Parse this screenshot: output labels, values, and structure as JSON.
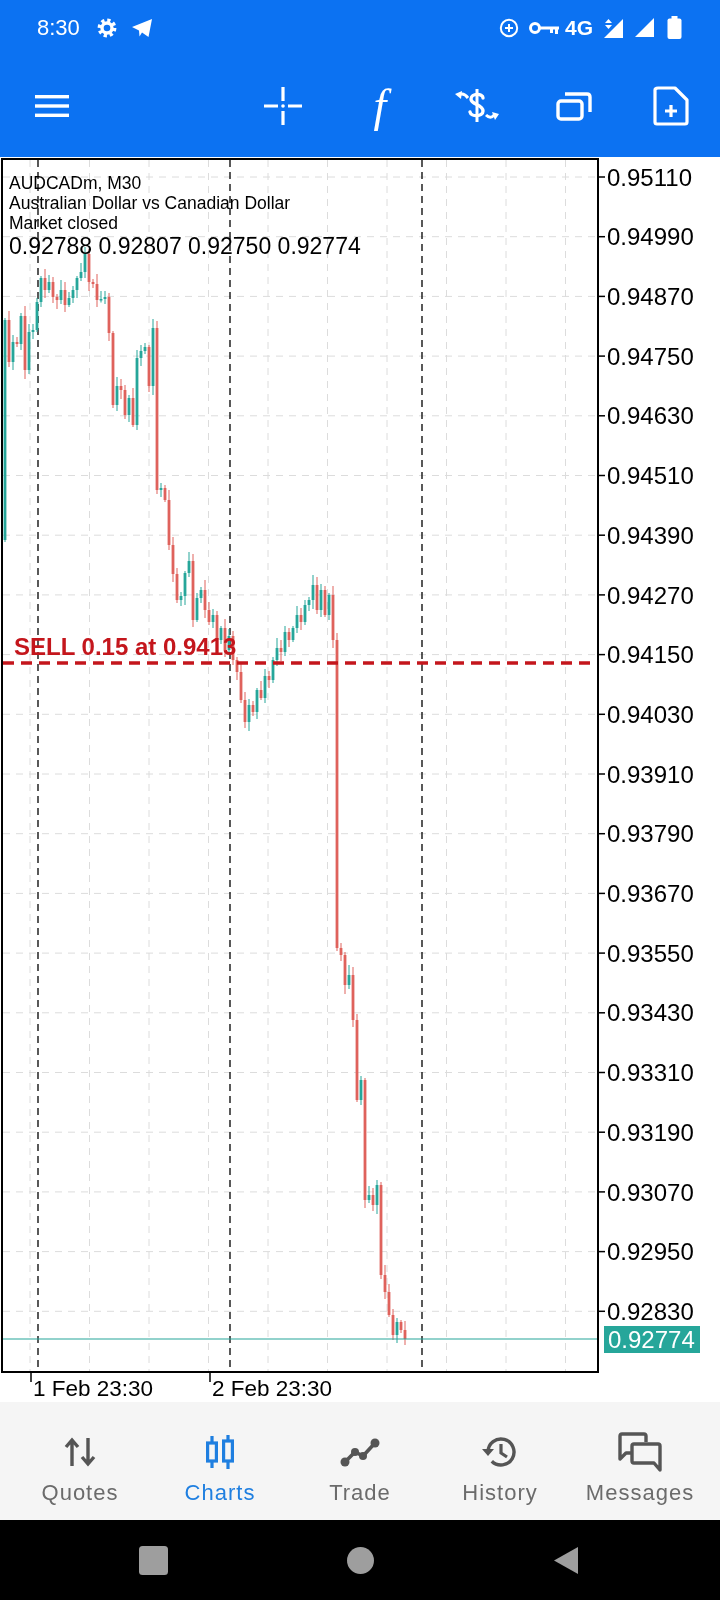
{
  "status_bar": {
    "time": "8:30",
    "network": "4G"
  },
  "toolbar": {
    "function_symbol": "f"
  },
  "chart": {
    "symbol": "AUDCADm, M30",
    "description": "Australian Dollar vs Canadian Dollar",
    "market_status": "Market closed",
    "ohlc": "0.92788 0.92807 0.92750 0.92774",
    "order_line": {
      "label": "SELL 0.15 at 0.9413"
    },
    "price_axis": [
      "0.95110",
      "0.94990",
      "0.94870",
      "0.94750",
      "0.94630",
      "0.94510",
      "0.94390",
      "0.94270",
      "0.94150",
      "0.94030",
      "0.93910",
      "0.93790",
      "0.93670",
      "0.93550",
      "0.93430",
      "0.93310",
      "0.93190",
      "0.93070",
      "0.92950",
      "0.92830"
    ],
    "current_price": "0.92774",
    "time_axis": [
      "1 Feb 23:30",
      "2 Feb 23:30"
    ]
  },
  "bottom_nav": [
    {
      "label": "Quotes",
      "selected": false
    },
    {
      "label": "Charts",
      "selected": true
    },
    {
      "label": "Trade",
      "selected": false
    },
    {
      "label": "History",
      "selected": false
    },
    {
      "label": "Messages",
      "selected": false
    }
  ]
}
